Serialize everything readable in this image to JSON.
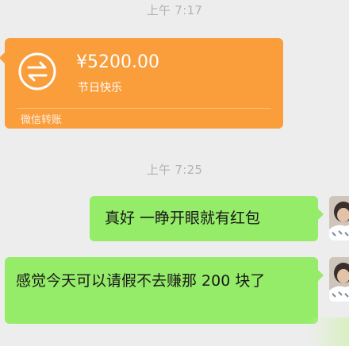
{
  "chat": {
    "timestamps": [
      "上午 7:17",
      "上午 7:25"
    ],
    "transfer": {
      "amount": "¥5200.00",
      "note": "节日快乐",
      "footer": "微信转账",
      "icon": "transfer-arrows-icon",
      "color": "#fa9d3b"
    },
    "messages": [
      {
        "text": "真好 一睁开眼就有红包",
        "side": "right"
      },
      {
        "text": "感觉今天可以请假不去赚那 200 块了",
        "side": "right"
      }
    ],
    "bubble_color": "#95ec69"
  }
}
